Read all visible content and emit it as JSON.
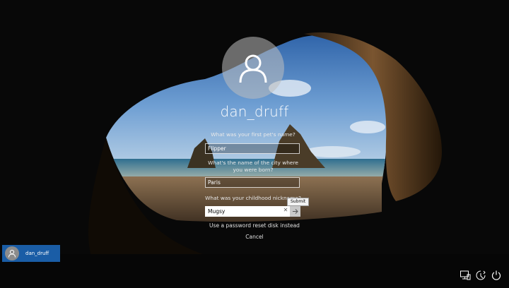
{
  "user": {
    "name": "dan_druff"
  },
  "questions": [
    {
      "label": "What was your first pet's name?",
      "answer": "Flipper"
    },
    {
      "label": "What's the name of the city where you were born?",
      "answer": "Paris"
    },
    {
      "label": "What was your childhood nickname?",
      "answer": "Mugsy"
    }
  ],
  "submit": {
    "tooltip": "Submit"
  },
  "links": {
    "reset_disk": "Use a password reset disk instead",
    "cancel": "Cancel"
  },
  "account_switcher": {
    "name": "dan_druff"
  },
  "system_icons": [
    "network-icon",
    "ease-of-access-icon",
    "power-icon"
  ],
  "colors": {
    "accent": "#1a5da6",
    "field_border": "#ffffff"
  }
}
